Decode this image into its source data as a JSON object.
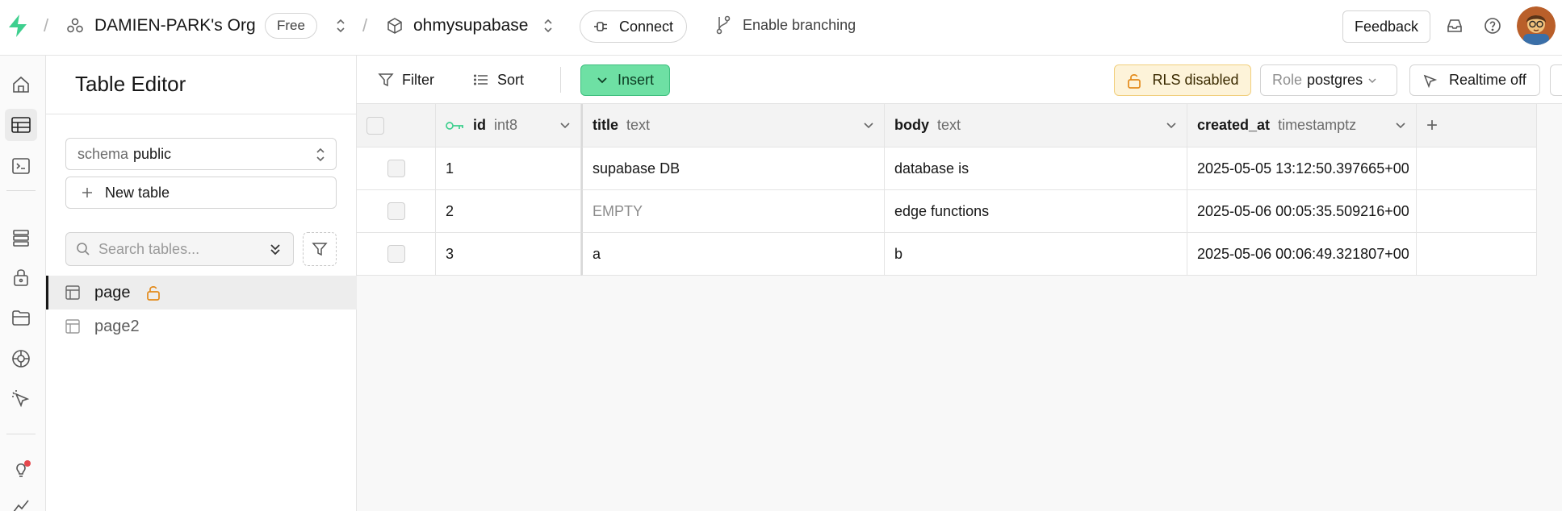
{
  "header": {
    "org_name": "DAMIEN-PARK's Org",
    "plan_badge": "Free",
    "project_name": "ohmysupabase",
    "connect_label": "Connect",
    "branching_label": "Enable branching",
    "feedback_label": "Feedback"
  },
  "sidebar": {
    "title": "Table Editor",
    "schema_label": "schema",
    "schema_value": "public",
    "new_table_label": "New table",
    "search_placeholder": "Search tables...",
    "tables": [
      {
        "name": "page",
        "active": true,
        "rls_unlocked": true
      },
      {
        "name": "page2",
        "active": false,
        "rls_unlocked": false
      }
    ]
  },
  "toolbar": {
    "filter_label": "Filter",
    "sort_label": "Sort",
    "insert_label": "Insert",
    "rls_label": "RLS disabled",
    "role_label": "Role",
    "role_value": "postgres",
    "realtime_label": "Realtime off"
  },
  "grid": {
    "columns": [
      {
        "name": "id",
        "type": "int8",
        "primary_key": true
      },
      {
        "name": "title",
        "type": "text"
      },
      {
        "name": "body",
        "type": "text"
      },
      {
        "name": "created_at",
        "type": "timestamptz"
      }
    ],
    "rows": [
      {
        "id": "1",
        "title": "supabase DB",
        "body": "database is",
        "created_at": "2025-05-05 13:12:50.397665+00"
      },
      {
        "id": "2",
        "title": "EMPTY",
        "body": "edge functions",
        "created_at": "2025-05-06 00:05:35.509216+00"
      },
      {
        "id": "3",
        "title": "a",
        "body": "b",
        "created_at": "2025-05-06 00:06:49.321807+00"
      }
    ],
    "add_column_symbol": "+"
  },
  "colors": {
    "brand_green": "#3ecf8e",
    "insert_bg": "#6ee0a4",
    "rls_warning_bg": "#fdf3d9",
    "lock_orange": "#e38a1a",
    "notification_red": "#e5484d"
  }
}
